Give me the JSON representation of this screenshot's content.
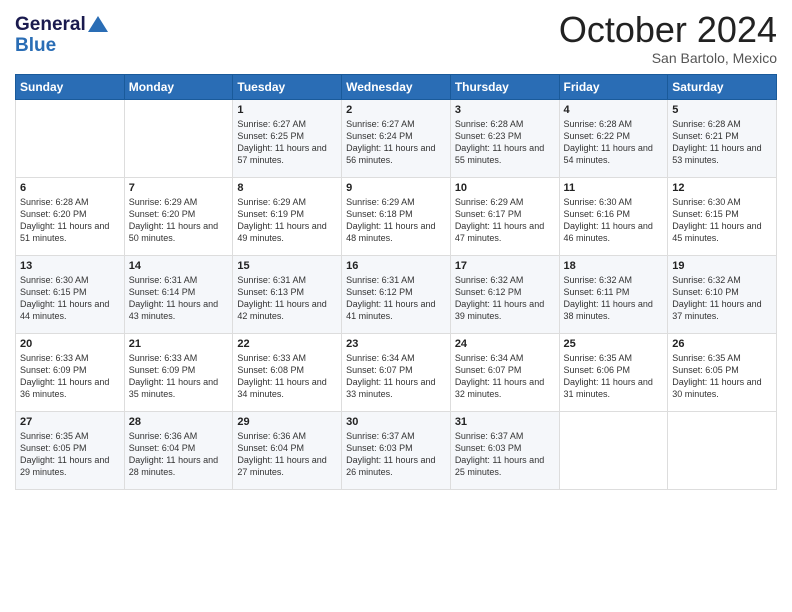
{
  "header": {
    "logo_general": "General",
    "logo_blue": "Blue",
    "month": "October 2024",
    "location": "San Bartolo, Mexico"
  },
  "days_of_week": [
    "Sunday",
    "Monday",
    "Tuesday",
    "Wednesday",
    "Thursday",
    "Friday",
    "Saturday"
  ],
  "weeks": [
    [
      {
        "day": "",
        "sunrise": "",
        "sunset": "",
        "daylight": ""
      },
      {
        "day": "",
        "sunrise": "",
        "sunset": "",
        "daylight": ""
      },
      {
        "day": "1",
        "sunrise": "Sunrise: 6:27 AM",
        "sunset": "Sunset: 6:25 PM",
        "daylight": "Daylight: 11 hours and 57 minutes."
      },
      {
        "day": "2",
        "sunrise": "Sunrise: 6:27 AM",
        "sunset": "Sunset: 6:24 PM",
        "daylight": "Daylight: 11 hours and 56 minutes."
      },
      {
        "day": "3",
        "sunrise": "Sunrise: 6:28 AM",
        "sunset": "Sunset: 6:23 PM",
        "daylight": "Daylight: 11 hours and 55 minutes."
      },
      {
        "day": "4",
        "sunrise": "Sunrise: 6:28 AM",
        "sunset": "Sunset: 6:22 PM",
        "daylight": "Daylight: 11 hours and 54 minutes."
      },
      {
        "day": "5",
        "sunrise": "Sunrise: 6:28 AM",
        "sunset": "Sunset: 6:21 PM",
        "daylight": "Daylight: 11 hours and 53 minutes."
      }
    ],
    [
      {
        "day": "6",
        "sunrise": "Sunrise: 6:28 AM",
        "sunset": "Sunset: 6:20 PM",
        "daylight": "Daylight: 11 hours and 51 minutes."
      },
      {
        "day": "7",
        "sunrise": "Sunrise: 6:29 AM",
        "sunset": "Sunset: 6:20 PM",
        "daylight": "Daylight: 11 hours and 50 minutes."
      },
      {
        "day": "8",
        "sunrise": "Sunrise: 6:29 AM",
        "sunset": "Sunset: 6:19 PM",
        "daylight": "Daylight: 11 hours and 49 minutes."
      },
      {
        "day": "9",
        "sunrise": "Sunrise: 6:29 AM",
        "sunset": "Sunset: 6:18 PM",
        "daylight": "Daylight: 11 hours and 48 minutes."
      },
      {
        "day": "10",
        "sunrise": "Sunrise: 6:29 AM",
        "sunset": "Sunset: 6:17 PM",
        "daylight": "Daylight: 11 hours and 47 minutes."
      },
      {
        "day": "11",
        "sunrise": "Sunrise: 6:30 AM",
        "sunset": "Sunset: 6:16 PM",
        "daylight": "Daylight: 11 hours and 46 minutes."
      },
      {
        "day": "12",
        "sunrise": "Sunrise: 6:30 AM",
        "sunset": "Sunset: 6:15 PM",
        "daylight": "Daylight: 11 hours and 45 minutes."
      }
    ],
    [
      {
        "day": "13",
        "sunrise": "Sunrise: 6:30 AM",
        "sunset": "Sunset: 6:15 PM",
        "daylight": "Daylight: 11 hours and 44 minutes."
      },
      {
        "day": "14",
        "sunrise": "Sunrise: 6:31 AM",
        "sunset": "Sunset: 6:14 PM",
        "daylight": "Daylight: 11 hours and 43 minutes."
      },
      {
        "day": "15",
        "sunrise": "Sunrise: 6:31 AM",
        "sunset": "Sunset: 6:13 PM",
        "daylight": "Daylight: 11 hours and 42 minutes."
      },
      {
        "day": "16",
        "sunrise": "Sunrise: 6:31 AM",
        "sunset": "Sunset: 6:12 PM",
        "daylight": "Daylight: 11 hours and 41 minutes."
      },
      {
        "day": "17",
        "sunrise": "Sunrise: 6:32 AM",
        "sunset": "Sunset: 6:12 PM",
        "daylight": "Daylight: 11 hours and 39 minutes."
      },
      {
        "day": "18",
        "sunrise": "Sunrise: 6:32 AM",
        "sunset": "Sunset: 6:11 PM",
        "daylight": "Daylight: 11 hours and 38 minutes."
      },
      {
        "day": "19",
        "sunrise": "Sunrise: 6:32 AM",
        "sunset": "Sunset: 6:10 PM",
        "daylight": "Daylight: 11 hours and 37 minutes."
      }
    ],
    [
      {
        "day": "20",
        "sunrise": "Sunrise: 6:33 AM",
        "sunset": "Sunset: 6:09 PM",
        "daylight": "Daylight: 11 hours and 36 minutes."
      },
      {
        "day": "21",
        "sunrise": "Sunrise: 6:33 AM",
        "sunset": "Sunset: 6:09 PM",
        "daylight": "Daylight: 11 hours and 35 minutes."
      },
      {
        "day": "22",
        "sunrise": "Sunrise: 6:33 AM",
        "sunset": "Sunset: 6:08 PM",
        "daylight": "Daylight: 11 hours and 34 minutes."
      },
      {
        "day": "23",
        "sunrise": "Sunrise: 6:34 AM",
        "sunset": "Sunset: 6:07 PM",
        "daylight": "Daylight: 11 hours and 33 minutes."
      },
      {
        "day": "24",
        "sunrise": "Sunrise: 6:34 AM",
        "sunset": "Sunset: 6:07 PM",
        "daylight": "Daylight: 11 hours and 32 minutes."
      },
      {
        "day": "25",
        "sunrise": "Sunrise: 6:35 AM",
        "sunset": "Sunset: 6:06 PM",
        "daylight": "Daylight: 11 hours and 31 minutes."
      },
      {
        "day": "26",
        "sunrise": "Sunrise: 6:35 AM",
        "sunset": "Sunset: 6:05 PM",
        "daylight": "Daylight: 11 hours and 30 minutes."
      }
    ],
    [
      {
        "day": "27",
        "sunrise": "Sunrise: 6:35 AM",
        "sunset": "Sunset: 6:05 PM",
        "daylight": "Daylight: 11 hours and 29 minutes."
      },
      {
        "day": "28",
        "sunrise": "Sunrise: 6:36 AM",
        "sunset": "Sunset: 6:04 PM",
        "daylight": "Daylight: 11 hours and 28 minutes."
      },
      {
        "day": "29",
        "sunrise": "Sunrise: 6:36 AM",
        "sunset": "Sunset: 6:04 PM",
        "daylight": "Daylight: 11 hours and 27 minutes."
      },
      {
        "day": "30",
        "sunrise": "Sunrise: 6:37 AM",
        "sunset": "Sunset: 6:03 PM",
        "daylight": "Daylight: 11 hours and 26 minutes."
      },
      {
        "day": "31",
        "sunrise": "Sunrise: 6:37 AM",
        "sunset": "Sunset: 6:03 PM",
        "daylight": "Daylight: 11 hours and 25 minutes."
      },
      {
        "day": "",
        "sunrise": "",
        "sunset": "",
        "daylight": ""
      },
      {
        "day": "",
        "sunrise": "",
        "sunset": "",
        "daylight": ""
      }
    ]
  ]
}
